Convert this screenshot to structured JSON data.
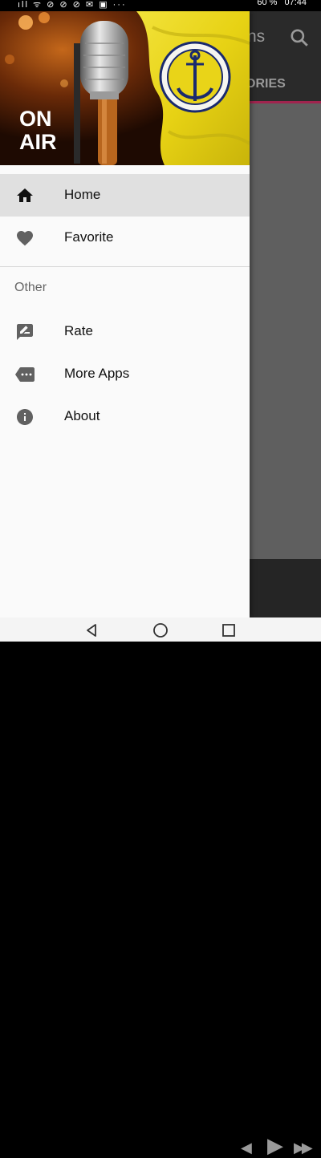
{
  "status_bar": {
    "left_icons": "ıll ᯤ ⊘ ⊘ ⊘ ✉ ▣ ···",
    "battery": "60 %",
    "time": "07:44"
  },
  "background_app": {
    "title_partial": "ns",
    "tab_partial": "ORIES",
    "tab_indicator_color": "#a0244e"
  },
  "drawer": {
    "header": {
      "text": "ON AIR"
    },
    "items": [
      {
        "label": "Home",
        "icon": "home-icon",
        "active": true
      },
      {
        "label": "Favorite",
        "icon": "heart-icon",
        "active": false
      }
    ],
    "section_title": "Other",
    "other_items": [
      {
        "label": "Rate",
        "icon": "rate-review-icon"
      },
      {
        "label": "More Apps",
        "icon": "more-apps-icon"
      },
      {
        "label": "About",
        "icon": "info-icon"
      }
    ]
  },
  "nav_bar": {
    "buttons": [
      "back-icon",
      "home-circle-icon",
      "recents-icon"
    ]
  }
}
